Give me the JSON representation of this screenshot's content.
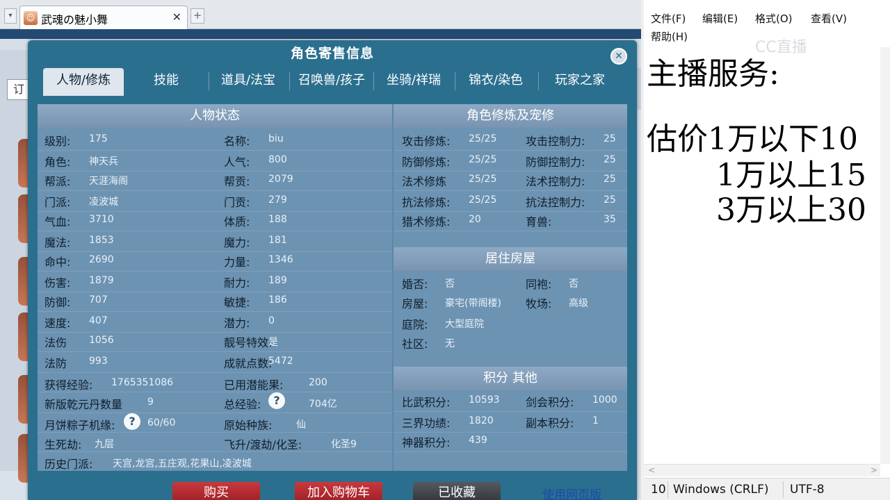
{
  "browser": {
    "tab_title": "武魂の魅小舞",
    "tab_close": "✕",
    "new_tab": "+",
    "toolbar_button": "订"
  },
  "dialog": {
    "title": "角色寄售信息",
    "close": "✕",
    "tabs": [
      "人物/修炼",
      "技能",
      "道具/法宝",
      "召唤兽/孩子",
      "坐骑/祥瑞",
      "锦衣/染色",
      "玩家之家"
    ],
    "status_section": {
      "header": "人物状态",
      "left": [
        {
          "label": "级别:",
          "value": "175"
        },
        {
          "label": "角色:",
          "value": "神天兵"
        },
        {
          "label": "帮派:",
          "value": "天涯海阁"
        },
        {
          "label": "门派:",
          "value": "凌波城"
        },
        {
          "label": "气血:",
          "value": "3710"
        },
        {
          "label": "魔法:",
          "value": "1853"
        },
        {
          "label": "命中:",
          "value": "2690"
        },
        {
          "label": "伤害:",
          "value": "1879"
        },
        {
          "label": "防御:",
          "value": "707"
        },
        {
          "label": "速度:",
          "value": "407"
        },
        {
          "label": "法伤",
          "value": "1056"
        },
        {
          "label": "法防",
          "value": "993"
        }
      ],
      "right": [
        {
          "label": "名称:",
          "value": "biu"
        },
        {
          "label": "人气:",
          "value": "800"
        },
        {
          "label": "帮贡:",
          "value": "2079"
        },
        {
          "label": "门贡:",
          "value": "279"
        },
        {
          "label": "体质:",
          "value": "188"
        },
        {
          "label": "魔力:",
          "value": "181"
        },
        {
          "label": "力量:",
          "value": "1346"
        },
        {
          "label": "耐力:",
          "value": "189"
        },
        {
          "label": "敏捷:",
          "value": "186"
        },
        {
          "label": "潜力:",
          "value": "0"
        },
        {
          "label": "靓号特效:",
          "value": "是"
        },
        {
          "label": "成就点数:",
          "value": "5472"
        }
      ],
      "exp_label": "获得经验:",
      "exp_value": "1765351086",
      "used_potential_label": "已用潜能果:",
      "used_potential_value": "200",
      "qianyuan_label": "新版乾元丹数量",
      "qianyuan_value": "9",
      "total_exp_label": "总经验:",
      "total_exp_value": "704亿",
      "mooncake_label": "月饼粽子机缘:",
      "mooncake_value": "60/60",
      "origin_race_label": "原始种族:",
      "origin_race_value": "仙",
      "life_death_label": "生死劫:",
      "life_death_value": "九层",
      "ascend_label": "飞升/渡劫/化圣:",
      "ascend_value": "化圣9",
      "history_label": "历史门派:",
      "history_value": "天宫,龙宫,五庄观,花果山,凌波城",
      "help_glyph": "?"
    },
    "cultivation_section": {
      "header": "角色修炼及宠修",
      "rows": [
        {
          "l1": "攻击修炼:",
          "v1": "25/25",
          "l2": "攻击控制力:",
          "v2": "25"
        },
        {
          "l1": "防御修炼:",
          "v1": "25/25",
          "l2": "防御控制力:",
          "v2": "25"
        },
        {
          "l1": "法术修炼",
          "v1": "25/25",
          "l2": "法术控制力:",
          "v2": "25"
        },
        {
          "l1": "抗法修炼:",
          "v1": "25/25",
          "l2": "抗法控制力:",
          "v2": "25"
        },
        {
          "l1": "猎术修炼:",
          "v1": "20",
          "l2": "育兽:",
          "v2": "35"
        }
      ]
    },
    "house_section": {
      "header": "居住房屋",
      "married_label": "婚否:",
      "married_value": "否",
      "robe_label": "同袍:",
      "robe_value": "否",
      "house_label": "房屋:",
      "house_value": "豪宅(带阁楼)",
      "ranch_label": "牧场:",
      "ranch_value": "高级",
      "yard_label": "庭院:",
      "yard_value": "大型庭院",
      "community_label": "社区:",
      "community_value": "无"
    },
    "score_section": {
      "header": "积分 其他",
      "rows": [
        {
          "l1": "比武积分:",
          "v1": "10593",
          "l2": "剑会积分:",
          "v2": "1000"
        },
        {
          "l1": "三界功绩:",
          "v1": "1820",
          "l2": "副本积分:",
          "v2": "1"
        },
        {
          "l1": "神器积分:",
          "v1": "439",
          "l2": "",
          "v2": ""
        }
      ]
    },
    "buttons": {
      "buy": "购买",
      "add_cart": "加入购物车",
      "collected": "已收藏",
      "web_version": "使用网页版"
    }
  },
  "notepad": {
    "menu": [
      "文件(F)",
      "编辑(E)",
      "格式(O)",
      "查看(V)",
      "帮助(H)"
    ],
    "watermark": "CC直播",
    "lines": [
      "主播服务:",
      "",
      "估价1万以下10",
      "1万以上15",
      "3万以上30"
    ],
    "status": {
      "position": "10",
      "line_ending": "Windows (CRLF)",
      "encoding": "UTF-8"
    }
  }
}
